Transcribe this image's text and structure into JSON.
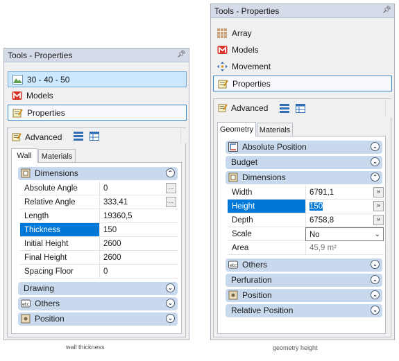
{
  "left_panel": {
    "title": "Tools - Properties",
    "pin_icon": "pin-icon",
    "nav": [
      {
        "label": "30 - 40 - 50",
        "icon": "landscape-icon"
      },
      {
        "label": "Models",
        "icon": "models-icon"
      },
      {
        "label": "Properties",
        "icon": "properties-icon"
      }
    ],
    "advanced_label": "Advanced",
    "tabs": [
      "Wall",
      "Materials"
    ],
    "groups": {
      "dimensions": "Dimensions",
      "drawing": "Drawing",
      "others": "Others",
      "position": "Position"
    },
    "rows": [
      {
        "label": "Absolute Angle",
        "value": "0",
        "ellipsis": "..."
      },
      {
        "label": "Relative Angle",
        "value": "333,41",
        "ellipsis": "..."
      },
      {
        "label": "Length",
        "value": "19360,5"
      },
      {
        "label": "Thickness",
        "value": "150"
      },
      {
        "label": "Initial Height",
        "value": "2600"
      },
      {
        "label": "Final Height",
        "value": "2600"
      },
      {
        "label": "Spacing Floor",
        "value": "0"
      }
    ],
    "caption": "wall thickness"
  },
  "right_panel": {
    "title": "Tools - Properties",
    "pin_icon": "pin-icon",
    "nav": [
      {
        "label": "Array",
        "icon": "array-icon"
      },
      {
        "label": "Models",
        "icon": "models-icon"
      },
      {
        "label": "Movement",
        "icon": "movement-icon"
      },
      {
        "label": "Properties",
        "icon": "properties-icon"
      }
    ],
    "advanced_label": "Advanced",
    "tabs": [
      "Geometry",
      "Materials"
    ],
    "groups": {
      "absolute_position": "Absolute Position",
      "budget": "Budget",
      "dimensions": "Dimensions",
      "others": "Others",
      "perfuration": "Perfuration",
      "position": "Position",
      "relative_position": "Relative Position"
    },
    "rows": [
      {
        "label": "Width",
        "value": "6791,1",
        "button": "»"
      },
      {
        "label": "Height",
        "value": "150",
        "button": "»"
      },
      {
        "label": "Depth",
        "value": "6758,8",
        "button": "»"
      },
      {
        "label": "Scale",
        "value": "No"
      },
      {
        "label": "Area",
        "value": "45,9 m²"
      }
    ],
    "caption": "geometry height"
  },
  "colors": {
    "selection": "#0078d7",
    "group_header": "#c8d9ee",
    "nav_selected": "#cce8ff",
    "models_red": "#d9342b"
  }
}
